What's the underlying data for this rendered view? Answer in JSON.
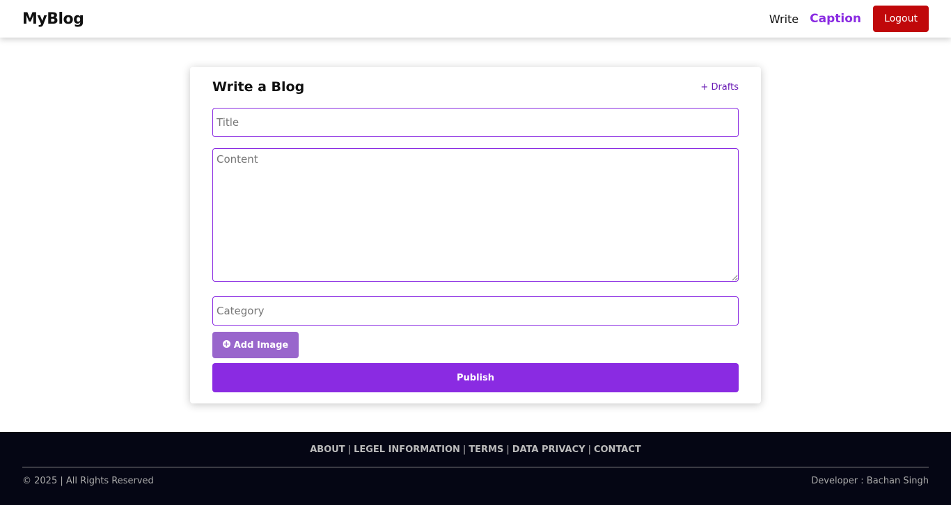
{
  "navbar": {
    "brand": "MyBlog",
    "write_link": "Write",
    "caption_link": "Caption",
    "logout_label": "Logout"
  },
  "editor": {
    "heading": "Write a Blog",
    "drafts_link": "+ Drafts",
    "title_placeholder": "Title",
    "title_value": "",
    "content_placeholder": "Content",
    "content_value": "",
    "category_placeholder": "Category",
    "category_value": "",
    "add_image_label": "Add Image",
    "publish_label": "Publish"
  },
  "footer": {
    "links": [
      "ABOUT",
      "LEGEL INFORMATION",
      "TERMS",
      "DATA PRIVACY",
      "CONTACT"
    ],
    "separator": "|",
    "copyright": "© 2025 | All Rights Reserved",
    "developer": "Developer : Bachan Singh"
  },
  "colors": {
    "accent": "#8a2be2",
    "logout": "#c0080a",
    "add_image": "#9966cc",
    "footer_bg": "#050614"
  },
  "icons": {
    "add_image": "plus-circle-icon"
  }
}
